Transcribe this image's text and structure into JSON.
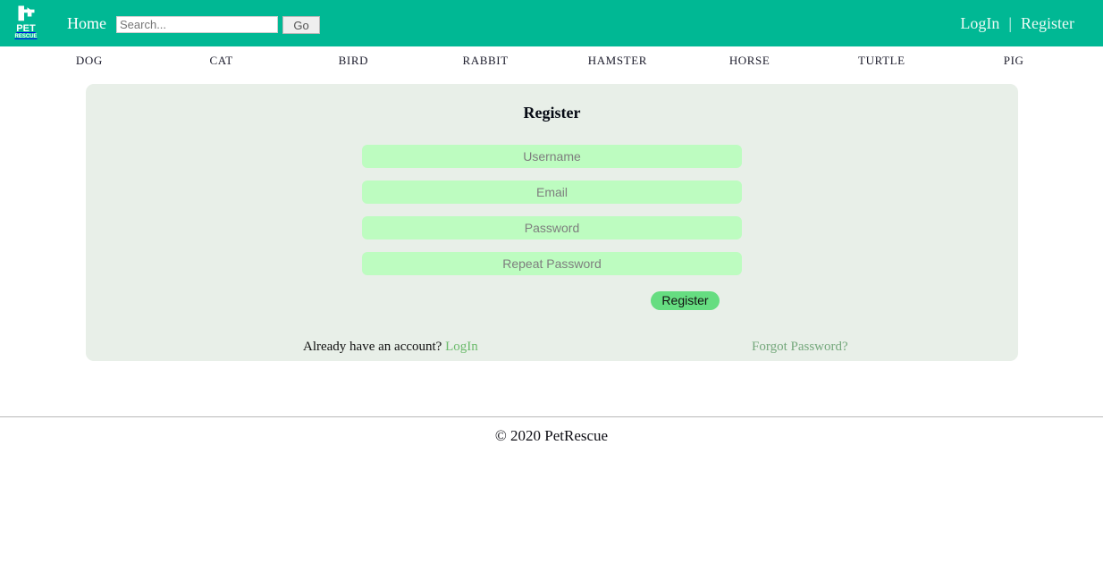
{
  "header": {
    "logo": {
      "icon": "dog-silhouette-icon",
      "line1": "PET",
      "line2": "RESCUE"
    },
    "home_label": "Home",
    "search": {
      "placeholder": "Search...",
      "value": "",
      "go_label": "Go"
    },
    "login_label": "LogIn",
    "separator": "|",
    "register_label": "Register",
    "background_color": "#00b894"
  },
  "categories": [
    {
      "label": "DOG",
      "color": "#e8423f"
    },
    {
      "label": "CAT",
      "color": "#7ac143"
    },
    {
      "label": "BIRD",
      "color": "#543d8a"
    },
    {
      "label": "RABBIT",
      "color": "#f7941e"
    },
    {
      "label": "HAMSTER",
      "color": "#00b3e3"
    },
    {
      "label": "HORSE",
      "color": "#f5459a"
    },
    {
      "label": "TURTLE",
      "color": "#7a3b07"
    },
    {
      "label": "PIG",
      "color": "#7210e0"
    }
  ],
  "register_card": {
    "title": "Register",
    "fields": [
      {
        "name": "username",
        "placeholder": "Username",
        "value": "",
        "type": "text"
      },
      {
        "name": "email",
        "placeholder": "Email",
        "value": "",
        "type": "text"
      },
      {
        "name": "password",
        "placeholder": "Password",
        "value": "",
        "type": "password"
      },
      {
        "name": "repeat_password",
        "placeholder": "Repeat Password",
        "value": "",
        "type": "password"
      }
    ],
    "submit_label": "Register",
    "have_account_text": "Already have an account?",
    "login_link_label": "LogIn",
    "forgot_password_label": "Forgot Password?",
    "card_background": "#e8efe8",
    "field_background": "#bdfcc0",
    "button_background": "#66dd81"
  },
  "footer": {
    "copyright": "© 2020 PetRescue"
  }
}
